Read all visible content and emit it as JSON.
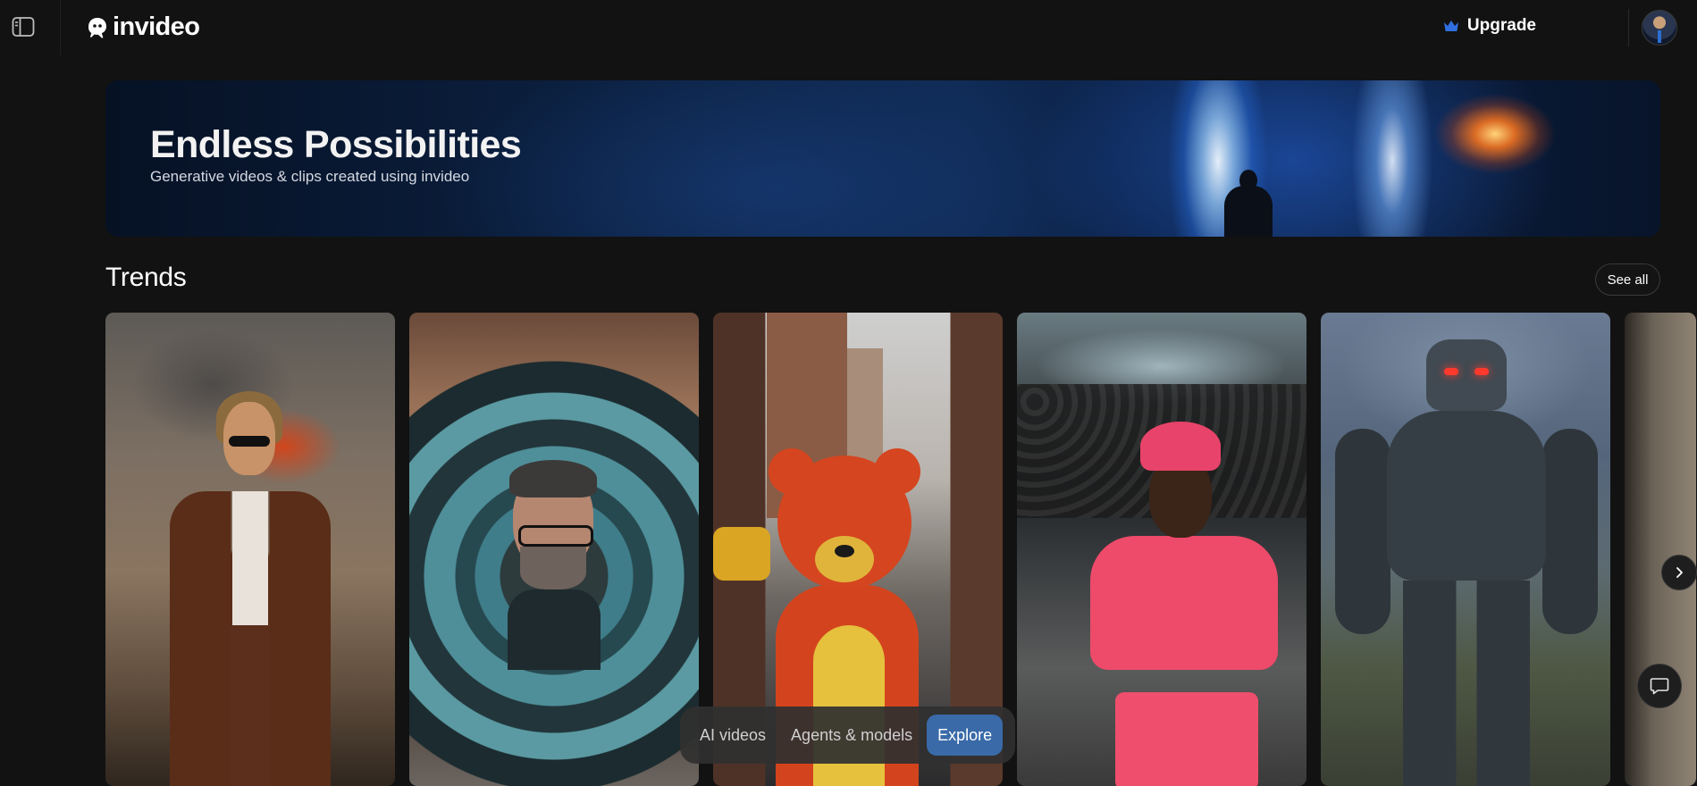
{
  "header": {
    "logo_text": "invideo",
    "upgrade_label": "Upgrade",
    "upgrade_icon_color": "#2f6fe0"
  },
  "hero": {
    "title": "Endless Possibilities",
    "subtitle": "Generative videos & clips created using invideo"
  },
  "trends": {
    "title": "Trends",
    "see_all_label": "See all"
  },
  "bottom_nav": {
    "items": [
      {
        "label": "AI videos",
        "active": false
      },
      {
        "label": "Agents & models",
        "active": false
      },
      {
        "label": "Explore",
        "active": true
      }
    ],
    "active_color": "#3a6aa8"
  }
}
